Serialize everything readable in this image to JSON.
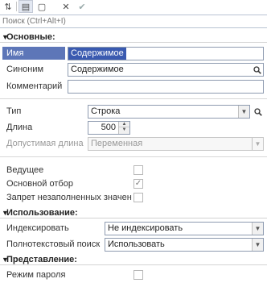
{
  "toolbar": {
    "buttons": [
      {
        "icon": "sort-icon",
        "glyph": "⇅"
      },
      {
        "icon": "categories-icon",
        "glyph": "▤"
      },
      {
        "icon": "document-icon",
        "glyph": "▢"
      },
      {
        "icon": "close-icon",
        "glyph": "✕"
      },
      {
        "icon": "check-icon",
        "glyph": "✔"
      }
    ]
  },
  "search": {
    "placeholder": "Поиск (Ctrl+Alt+I)"
  },
  "sections": {
    "main": "Основные:",
    "usage": "Использование:",
    "presentation": "Представление:"
  },
  "fields": {
    "name": {
      "label": "Имя",
      "value": "Содержимое"
    },
    "synonym": {
      "label": "Синоним",
      "value": "Содержимое"
    },
    "comment": {
      "label": "Комментарий",
      "value": ""
    },
    "type": {
      "label": "Тип",
      "value": "Строка"
    },
    "length": {
      "label": "Длина",
      "value": "500"
    },
    "allowed_length": {
      "label": "Допустимая длина",
      "value": "Переменная"
    },
    "leading": {
      "label": "Ведущее",
      "checked": false
    },
    "main_filter": {
      "label": "Основной отбор",
      "checked": true
    },
    "forbid_empty": {
      "label": "Запрет незаполненных значен",
      "checked": false
    },
    "indexing": {
      "label": "Индексировать",
      "value": "Не индексировать"
    },
    "fulltext": {
      "label": "Полнотекстовый поиск",
      "value": "Использовать"
    },
    "password_mode": {
      "label": "Режим пароля",
      "checked": false
    }
  }
}
